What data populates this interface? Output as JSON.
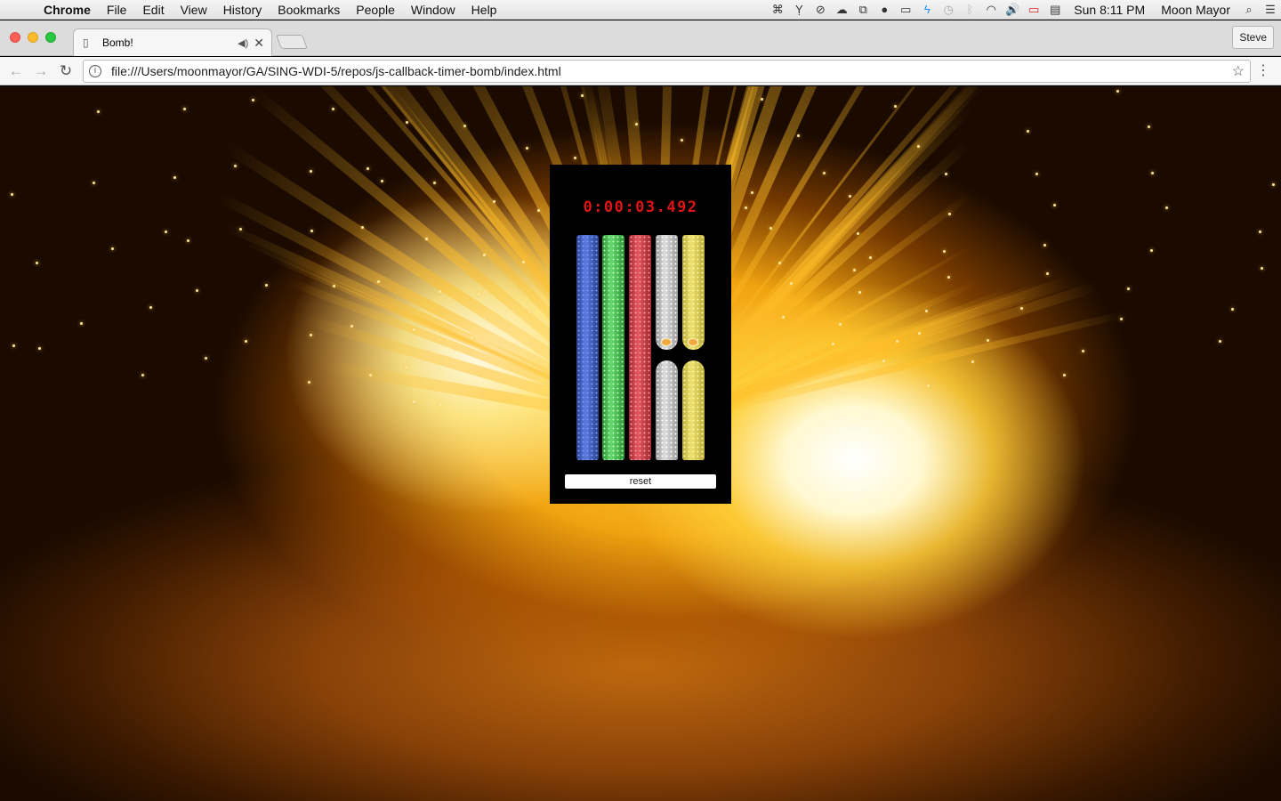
{
  "menubar": {
    "app_name": "Chrome",
    "items": [
      "File",
      "Edit",
      "View",
      "History",
      "Bookmarks",
      "People",
      "Window",
      "Help"
    ],
    "clock": "Sun 8:11 PM",
    "user": "Moon Mayor"
  },
  "browser": {
    "tab_title": "Bomb!",
    "profile": "Steve",
    "url": "file:///Users/moonmayor/GA/SING-WDI-5/repos/js-callback-timer-bomb/index.html"
  },
  "bomb": {
    "timer": "0:00:03.492",
    "reset_label": "reset",
    "wires": [
      {
        "color": "blue",
        "cut": false
      },
      {
        "color": "green",
        "cut": false
      },
      {
        "color": "red",
        "cut": false
      },
      {
        "color": "white",
        "cut": true
      },
      {
        "color": "yellow",
        "cut": true
      }
    ],
    "colors": {
      "timer": "#e01414",
      "panel": "#000000"
    }
  }
}
